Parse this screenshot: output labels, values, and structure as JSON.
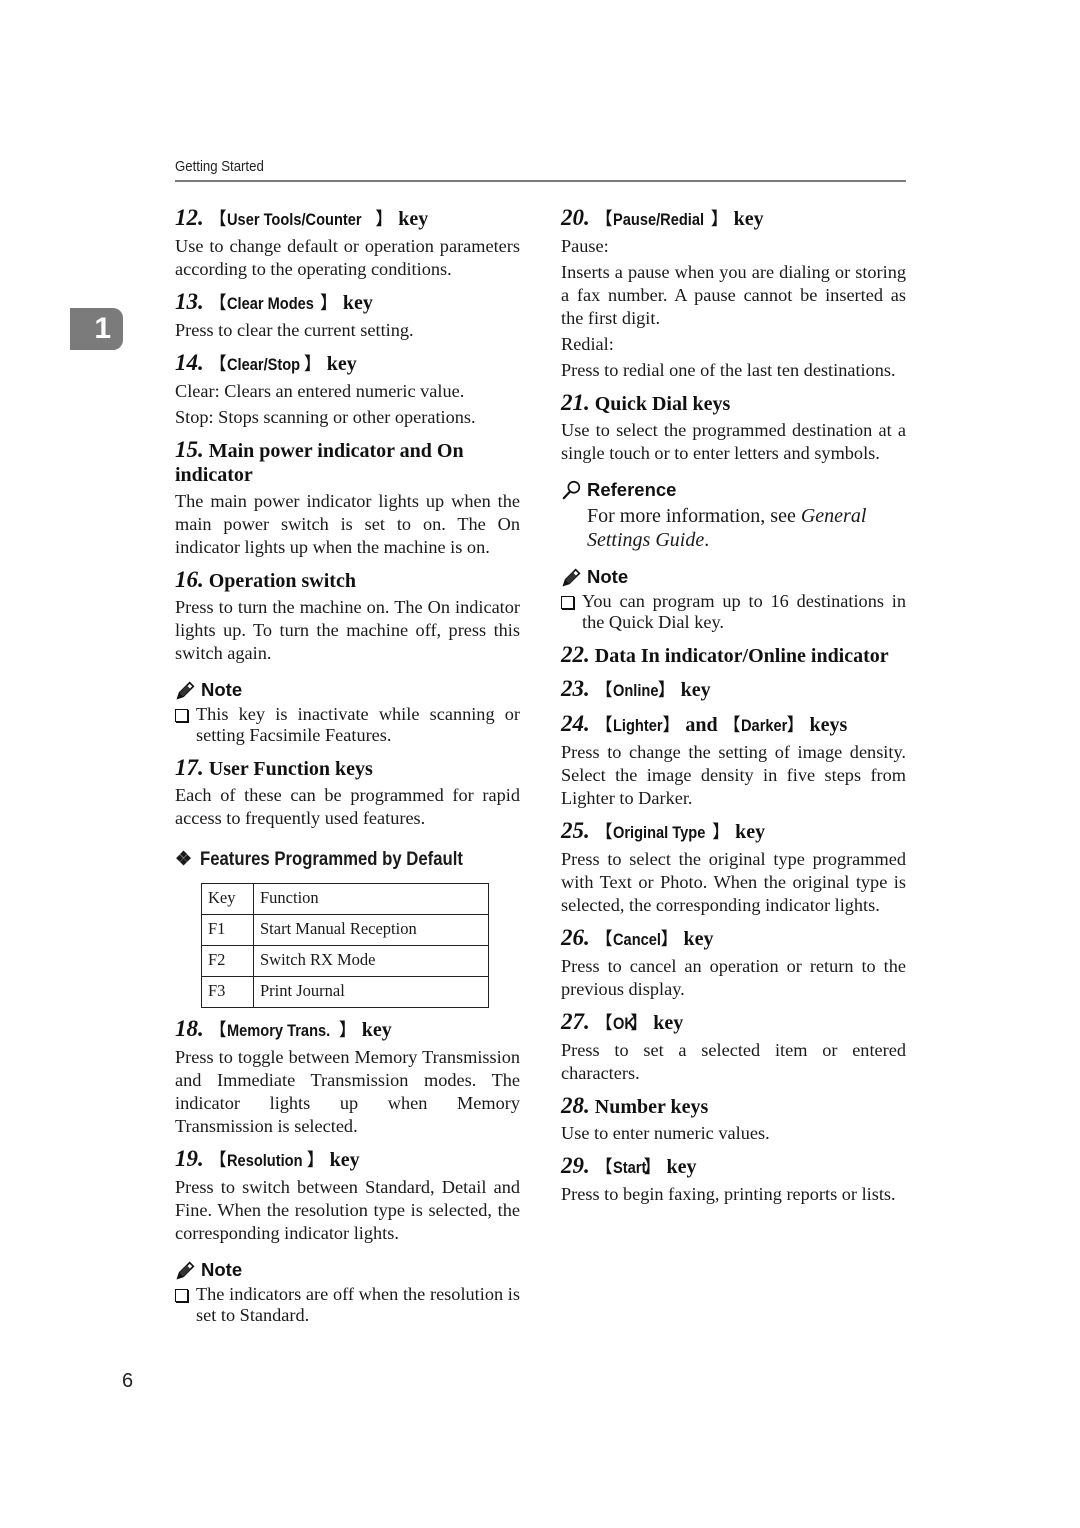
{
  "header": {
    "section": "Getting Started"
  },
  "chapter_tab": "1",
  "page_number": "6",
  "left_column": {
    "item12": {
      "num": "12.",
      "key": "User Tools/Counter",
      "suffix": "key",
      "body": "Use to change default or operation parameters according to the operating conditions."
    },
    "item13": {
      "num": "13.",
      "key": "Clear Modes",
      "suffix": "key",
      "body": "Press to clear the current setting."
    },
    "item14": {
      "num": "14.",
      "key": "Clear/Stop",
      "suffix": "key",
      "body1": "Clear: Clears an entered numeric value.",
      "body2": "Stop: Stops scanning or other operations."
    },
    "item15": {
      "num": "15.",
      "title": "Main power indicator and On indicator",
      "body": "The main power indicator lights up when the main power switch is set to on. The On indicator lights up when the machine is on."
    },
    "item16": {
      "num": "16.",
      "title": "Operation switch",
      "body": "Press to turn the machine on. The On indicator lights up. To turn the machine off, press this switch again.",
      "note_title": "Note",
      "note": "This key is inactivate while scanning or setting Facsimile Features."
    },
    "item17": {
      "num": "17.",
      "title": "User Function keys",
      "body": "Each of these can be programmed for rapid access to frequently used features.",
      "sub_heading": "Features Programmed by Default",
      "table": {
        "headers": [
          "Key",
          "Function"
        ],
        "rows": [
          [
            "F1",
            "Start Manual Reception"
          ],
          [
            "F2",
            "Switch RX Mode"
          ],
          [
            "F3",
            "Print Journal"
          ]
        ]
      }
    },
    "item18": {
      "num": "18.",
      "key": "Memory Trans.",
      "suffix": "key",
      "body": "Press to toggle between Memory Transmission and Immediate Transmission modes. The indicator lights up when Memory Transmission is selected."
    },
    "item19": {
      "num": "19.",
      "key": "Resolution",
      "suffix": "key",
      "body": "Press to switch between Standard, Detail and Fine. When the resolution type is selected, the corresponding indicator lights.",
      "note_title": "Note",
      "note": "The indicators are off when the resolution is set to Standard."
    }
  },
  "right_column": {
    "item20": {
      "num": "20.",
      "key": "Pause/Redial",
      "suffix": "key",
      "label1": "Pause:",
      "body1": "Inserts a pause when you are dialing or storing a fax number. A pause cannot be inserted as the first digit.",
      "label2": "Redial:",
      "body2": "Press to redial one of the last ten destinations."
    },
    "item21": {
      "num": "21.",
      "title": "Quick Dial keys",
      "body": "Use to select the programmed destination at a single touch or to enter letters and symbols.",
      "reference_title": "Reference",
      "reference_prefix": "For more information, see ",
      "reference_link": "General Settings Guide",
      "reference_suffix": ".",
      "note_title": "Note",
      "note": "You can program up to 16 destinations in the Quick Dial key."
    },
    "item22": {
      "num": "22.",
      "title": "Data In indicator/Online indicator"
    },
    "item23": {
      "num": "23.",
      "key": "Online",
      "suffix": "key"
    },
    "item24": {
      "num": "24.",
      "key1": "Lighter",
      "mid": "and",
      "key2": "Darker",
      "suffix": "keys",
      "body": "Press to change the setting of image density. Select the image density in five steps from Lighter to Darker."
    },
    "item25": {
      "num": "25.",
      "key": "Original Type",
      "suffix": "key",
      "body": "Press to select the original type programmed with Text or Photo. When the original type is selected, the corresponding indicator lights."
    },
    "item26": {
      "num": "26.",
      "key": "Cancel",
      "suffix": "key",
      "body": "Press to cancel an operation or return to the previous display."
    },
    "item27": {
      "num": "27.",
      "key": "OK",
      "suffix": "key",
      "body": "Press to set a selected item or entered characters."
    },
    "item28": {
      "num": "28.",
      "title": "Number keys",
      "body": "Use to enter numeric values."
    },
    "item29": {
      "num": "29.",
      "key": "Start",
      "suffix": "key",
      "body": "Press to begin faxing, printing reports or lists."
    }
  }
}
